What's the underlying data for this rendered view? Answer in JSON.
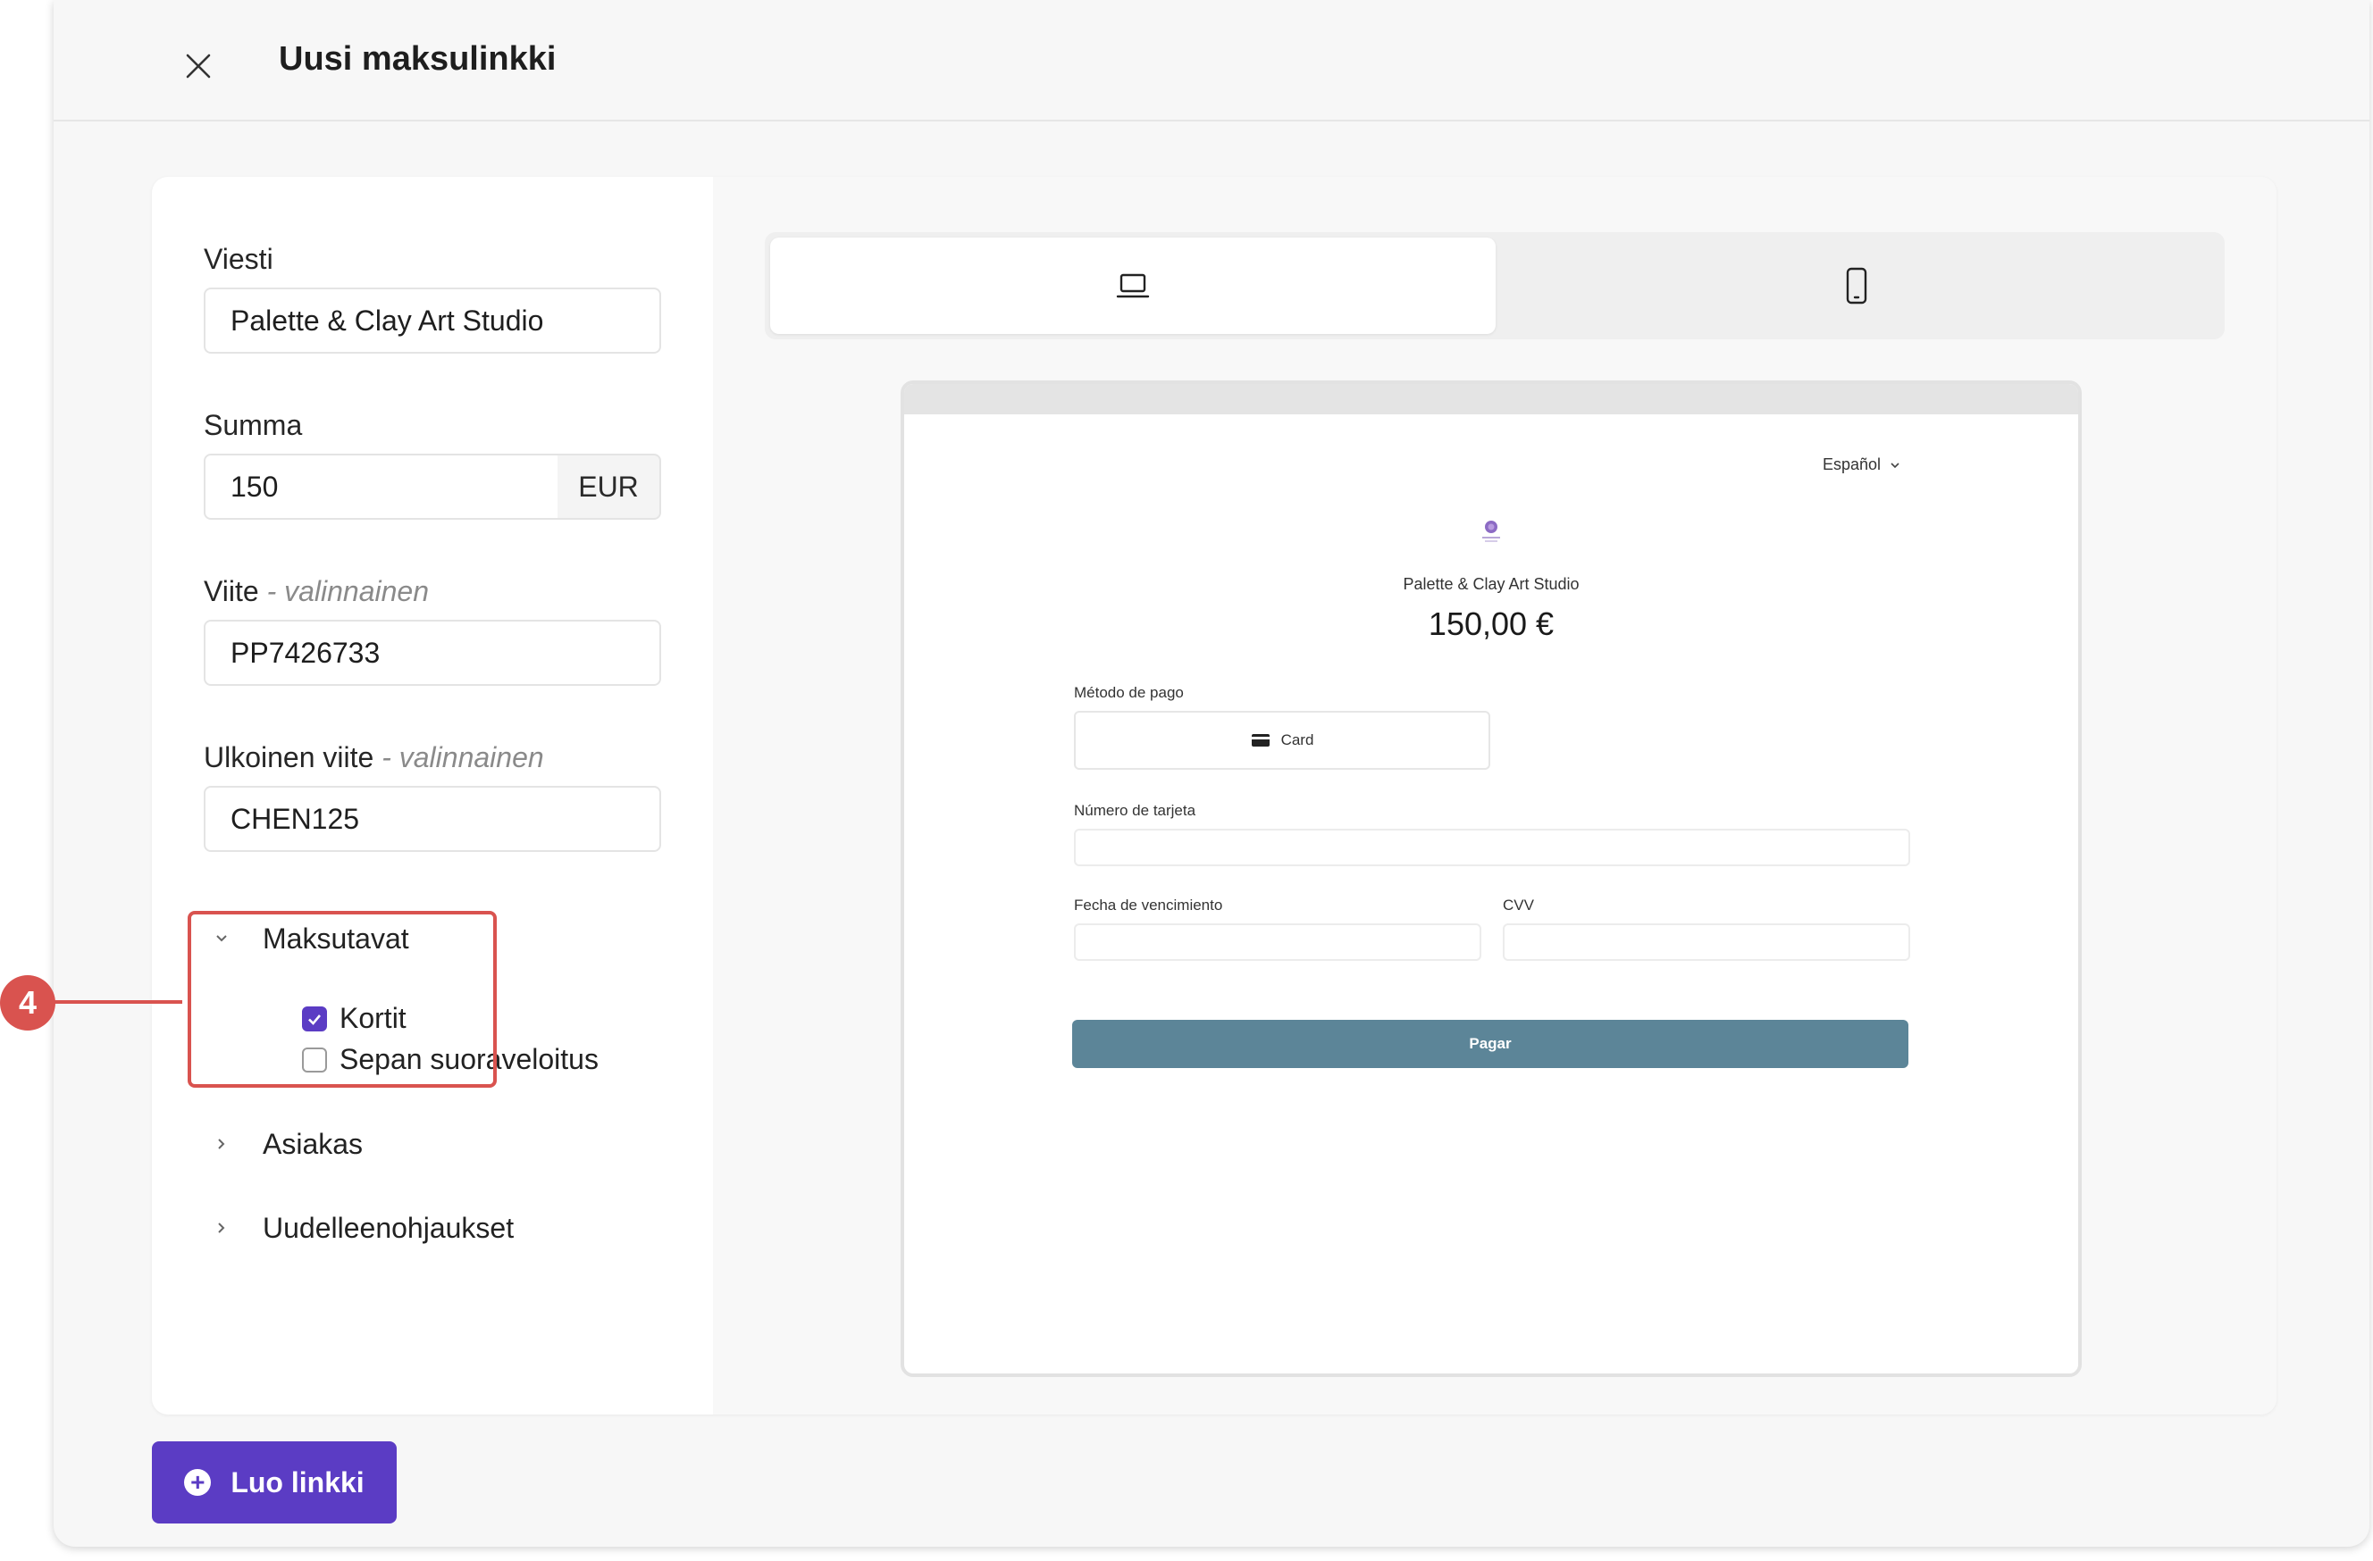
{
  "header": {
    "title": "Uusi maksulinkki"
  },
  "form": {
    "message": {
      "label": "Viesti",
      "value": "Palette & Clay Art Studio"
    },
    "amount": {
      "label": "Summa",
      "value": "150",
      "currency": "EUR"
    },
    "reference": {
      "label": "Viite",
      "optional": "- valinnainen",
      "value": "PP7426733"
    },
    "external_reference": {
      "label": "Ulkoinen viite",
      "optional": "- valinnainen",
      "value": "CHEN125"
    },
    "payment_methods": {
      "label": "Maksutavat",
      "options": [
        {
          "label": "Kortit",
          "checked": true
        },
        {
          "label": "Sepan suoraveloitus",
          "checked": false
        }
      ]
    },
    "customer": {
      "label": "Asiakas"
    },
    "redirects": {
      "label": "Uudelleenohjaukset"
    }
  },
  "callout": {
    "number": "4"
  },
  "preview": {
    "language": "Español",
    "merchant": "Palette & Clay Art Studio",
    "price": "150,00 €",
    "payment_method_label": "Método de pago",
    "payment_method_value": "Card",
    "card_number_label": "Número de tarjeta",
    "expiry_label": "Fecha de vencimiento",
    "cvv_label": "CVV",
    "pay_button": "Pagar"
  },
  "footer": {
    "create_button": "Luo linkki"
  },
  "colors": {
    "accent": "#5b3cc4",
    "callout": "#d9534f",
    "pay_button": "#5c8598"
  }
}
